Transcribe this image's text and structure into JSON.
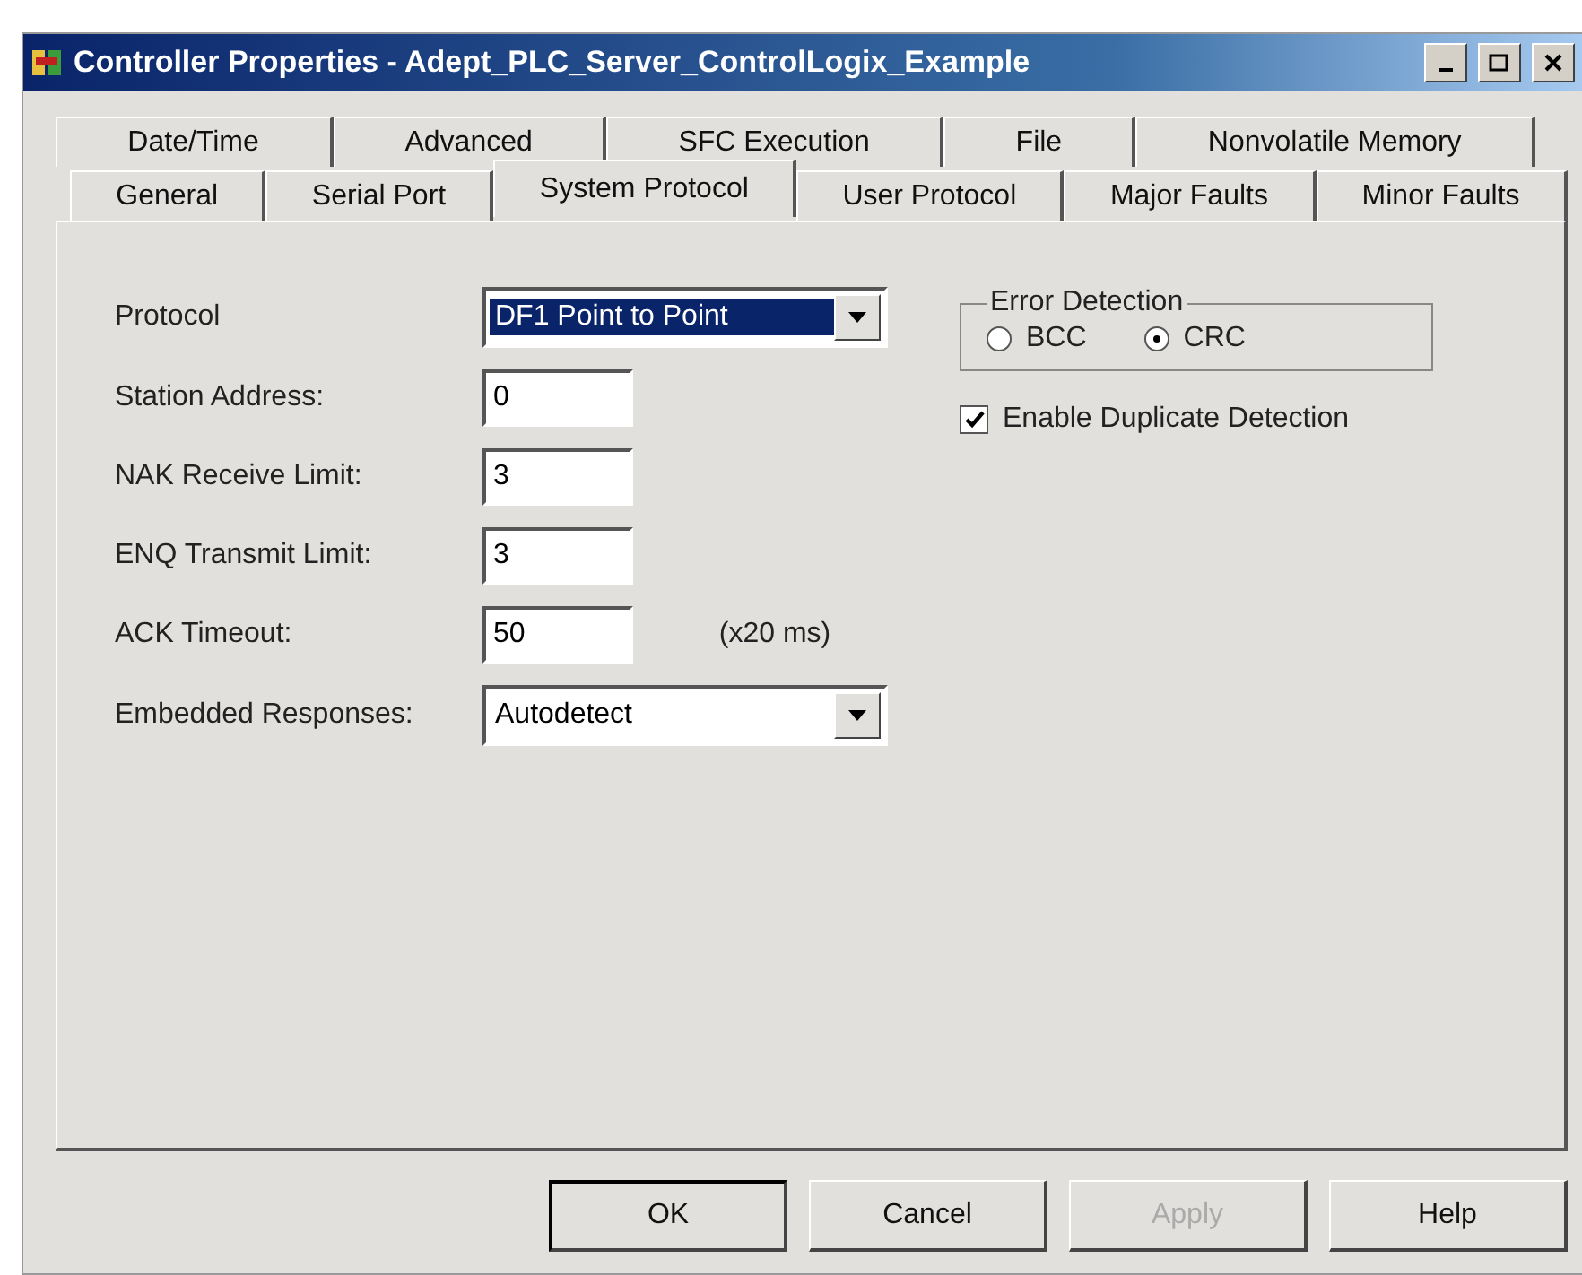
{
  "window": {
    "title": "Controller Properties - Adept_PLC_Server_ControlLogix_Example"
  },
  "tab_rows": [
    [
      {
        "label": "Date/Time",
        "selected": false
      },
      {
        "label": "Advanced",
        "selected": false
      },
      {
        "label": "SFC Execution",
        "selected": false
      },
      {
        "label": "File",
        "selected": false
      },
      {
        "label": "Nonvolatile Memory",
        "selected": false
      }
    ],
    [
      {
        "label": "General",
        "selected": false
      },
      {
        "label": "Serial Port",
        "selected": false
      },
      {
        "label": "System Protocol",
        "selected": true
      },
      {
        "label": "User Protocol",
        "selected": false
      },
      {
        "label": "Major Faults",
        "selected": false
      },
      {
        "label": "Minor Faults",
        "selected": false
      }
    ]
  ],
  "fields": [
    {
      "kind": "select",
      "label": "Protocol",
      "value": "DF1 Point to Point",
      "focused": true
    },
    {
      "kind": "text",
      "label": "Station Address:",
      "value": "0"
    },
    {
      "kind": "text",
      "label": "NAK Receive Limit:",
      "value": "3"
    },
    {
      "kind": "text",
      "label": "ENQ Transmit Limit:",
      "value": "3"
    },
    {
      "kind": "text",
      "label": "ACK Timeout:",
      "value": "50",
      "unit": "(x20 ms)"
    },
    {
      "kind": "select",
      "label": "Embedded Responses:",
      "value": "Autodetect",
      "focused": false
    }
  ],
  "error_detection": {
    "title": "Error Detection",
    "options": [
      {
        "label": "BCC",
        "selected": false
      },
      {
        "label": "CRC",
        "selected": true
      }
    ]
  },
  "duplicate_detection": {
    "label": "Enable Duplicate Detection",
    "checked": true
  },
  "buttons": [
    {
      "label": "OK",
      "default": true,
      "disabled": false
    },
    {
      "label": "Cancel",
      "default": false,
      "disabled": false
    },
    {
      "label": "Apply",
      "default": false,
      "disabled": true
    },
    {
      "label": "Help",
      "default": false,
      "disabled": false
    }
  ]
}
